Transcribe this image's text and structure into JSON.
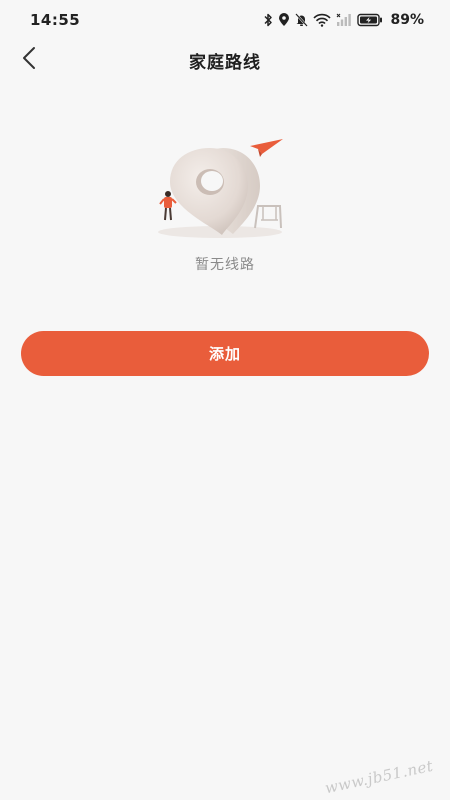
{
  "status_bar": {
    "time": "14:55",
    "battery_percent": "89%",
    "icons": [
      "bluetooth-icon",
      "location-icon",
      "mute-bell-icon",
      "wifi-icon",
      "signal-icon",
      "battery-charging-icon"
    ]
  },
  "header": {
    "title": "家庭路线",
    "back_icon": "chevron-left-icon"
  },
  "empty_state": {
    "illustration": "map-pin-empty-illustration",
    "message": "暂无线路"
  },
  "actions": {
    "add_label": "添加"
  },
  "watermark": {
    "text": "www.jb51.net"
  },
  "colors": {
    "accent": "#e95d3b",
    "background": "#f7f7f7",
    "muted_text": "#8a8a8a"
  }
}
